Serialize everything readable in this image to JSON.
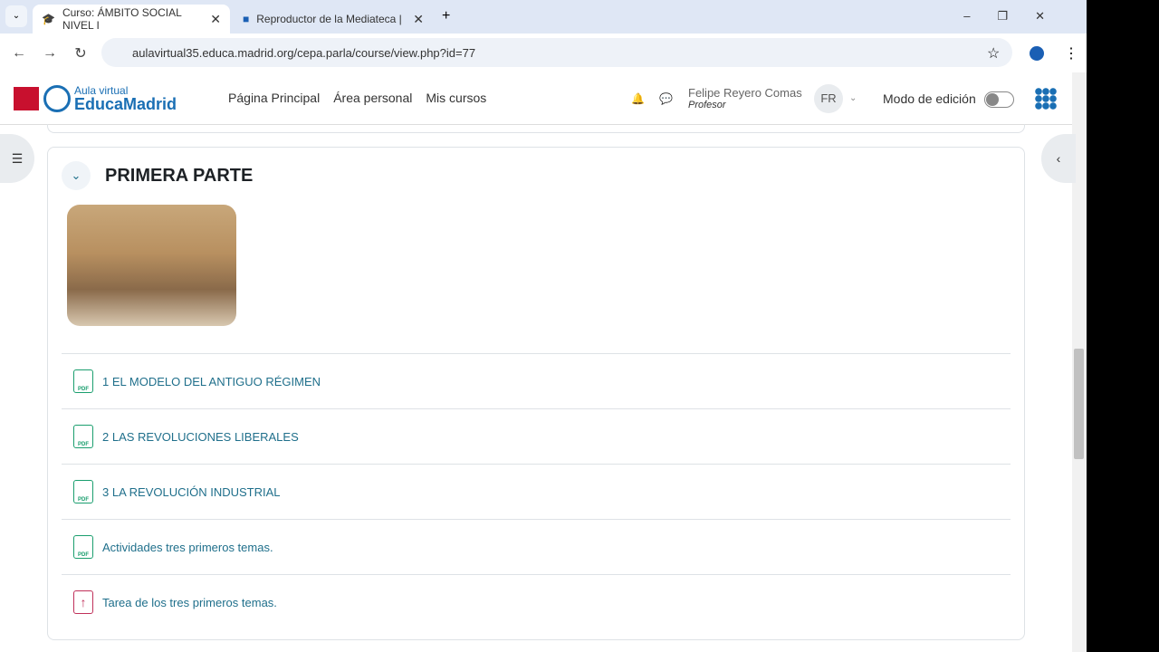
{
  "browser": {
    "tabs": [
      {
        "title": "Curso: ÁMBITO SOCIAL NIVEL I"
      },
      {
        "title": "Reproductor de la Mediateca |"
      }
    ],
    "url": "aulavirtual35.educa.madrid.org/cepa.parla/course/view.php?id=77"
  },
  "header": {
    "logo_top": "Aula virtual",
    "logo_bottom": "EducaMadrid",
    "nav": [
      "Página Principal",
      "Área personal",
      "Mis cursos"
    ],
    "user_name": "Felipe Reyero Comas",
    "user_role": "Profesor",
    "initials": "FR",
    "edit_mode": "Modo de edición",
    "edit_mode_on": false
  },
  "section": {
    "title": "PRIMERA PARTE",
    "items": [
      {
        "label": "1 EL MODELO DEL ANTIGUO RÉGIMEN",
        "type": "pdf",
        "icon_text": "PDF"
      },
      {
        "label": "2 LAS REVOLUCIONES LIBERALES",
        "type": "pdf",
        "icon_text": "PDF"
      },
      {
        "label": "3 LA REVOLUCIÓN INDUSTRIAL",
        "type": "pdf",
        "icon_text": "PDF"
      },
      {
        "label": "Actividades tres primeros temas.",
        "type": "pdf",
        "icon_text": "PDF"
      },
      {
        "label": "Tarea de los tres primeros temas.",
        "type": "assignment",
        "icon_text": "↑"
      }
    ]
  }
}
